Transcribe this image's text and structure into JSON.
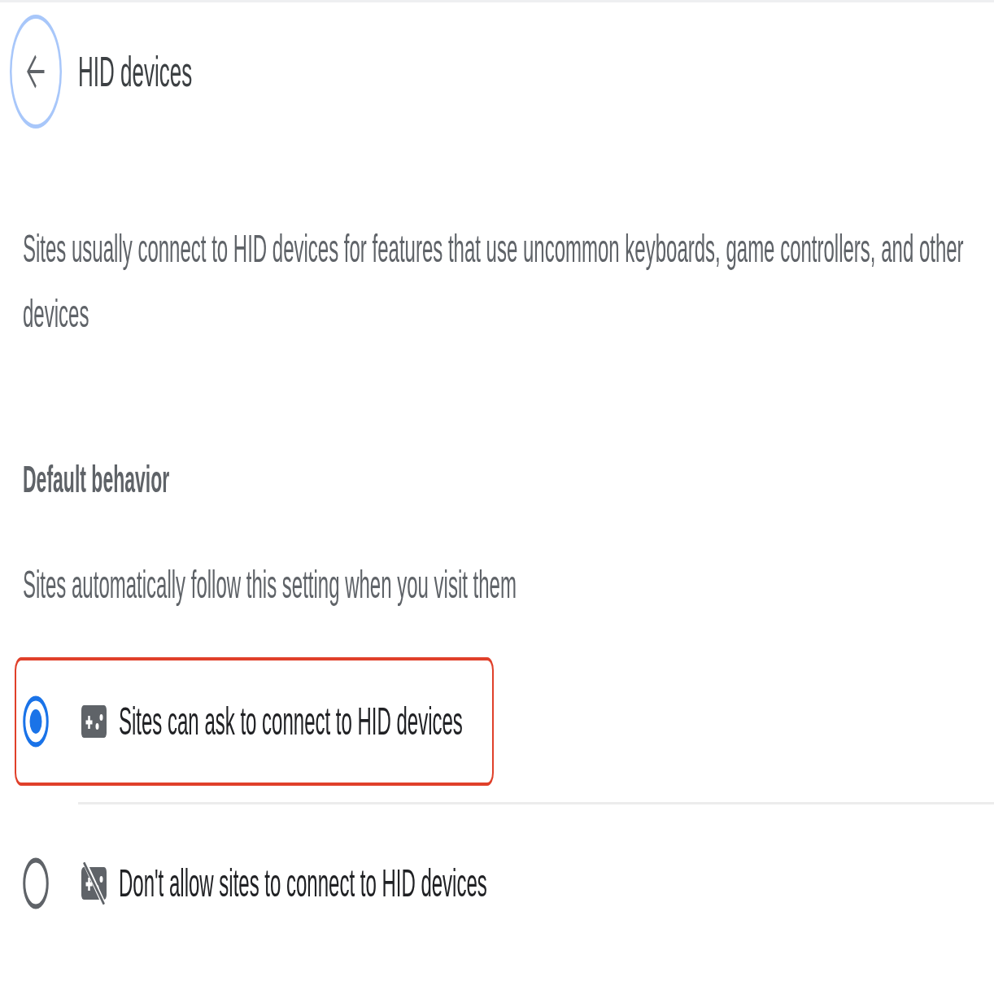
{
  "header": {
    "title": "HID devices"
  },
  "description": "Sites usually connect to HID devices for features that use uncommon keyboards, game controllers, and other devices",
  "default_behavior": {
    "heading": "Default behavior",
    "subtitle": "Sites automatically follow this setting when you visit them",
    "options": [
      {
        "kind": "allow",
        "label": "Sites can ask to connect to HID devices",
        "selected": true,
        "highlighted": true
      },
      {
        "kind": "block",
        "label": "Don't allow sites to connect to HID devices",
        "selected": false,
        "highlighted": false
      }
    ]
  }
}
